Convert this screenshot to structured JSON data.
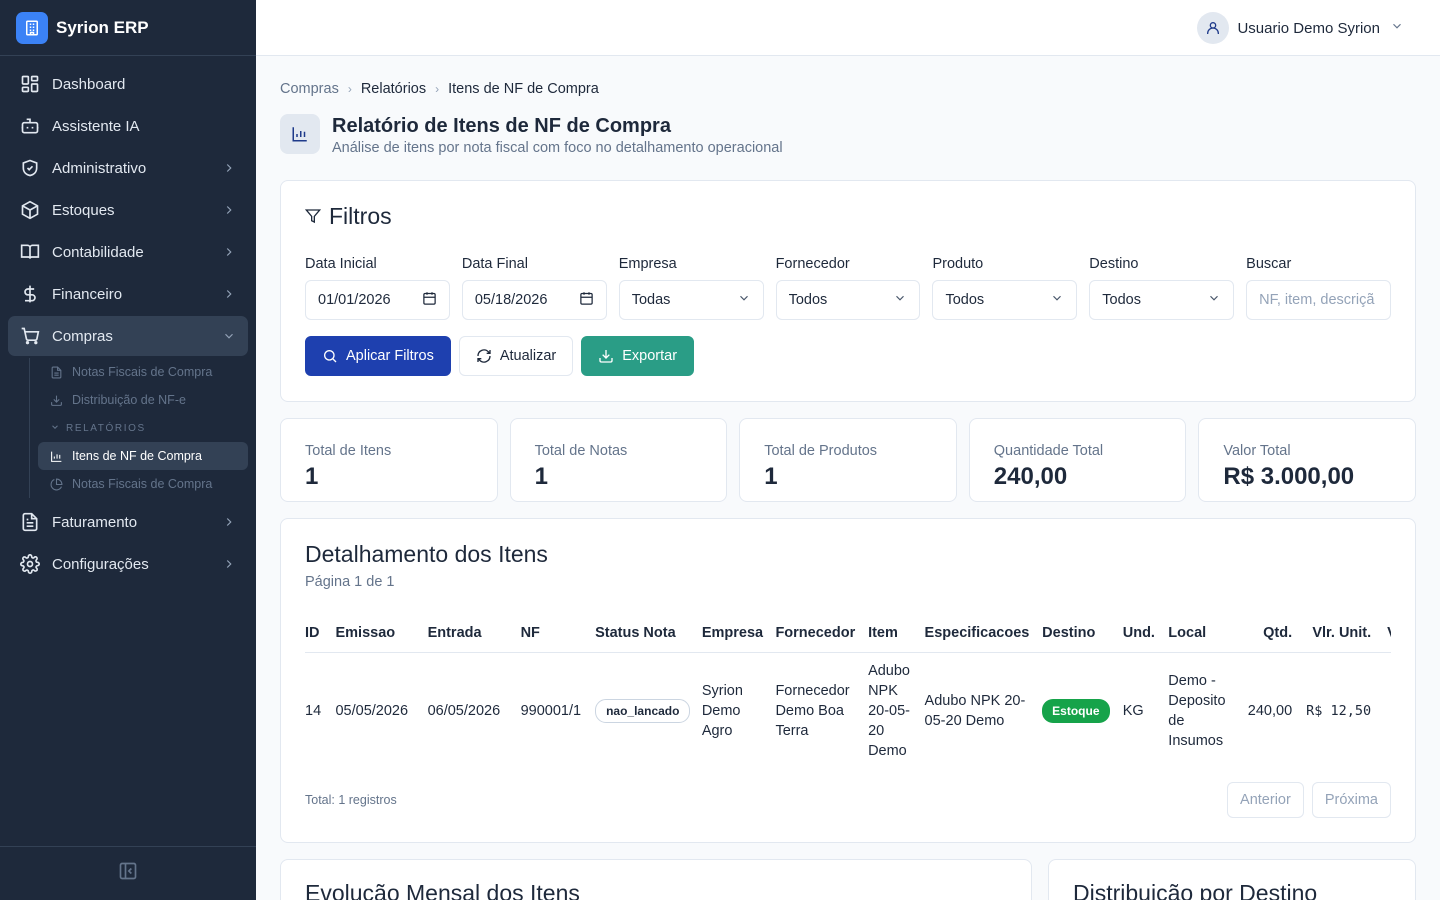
{
  "app": {
    "name": "Syrion ERP"
  },
  "user": {
    "name": "Usuario Demo Syrion"
  },
  "sidebar": {
    "items": [
      {
        "label": "Dashboard",
        "icon": "dashboard-icon"
      },
      {
        "label": "Assistente IA",
        "icon": "bot-icon"
      },
      {
        "label": "Administrativo",
        "icon": "shield-icon"
      },
      {
        "label": "Estoques",
        "icon": "package-icon"
      },
      {
        "label": "Contabilidade",
        "icon": "book-icon"
      },
      {
        "label": "Financeiro",
        "icon": "dollar-icon"
      },
      {
        "label": "Compras",
        "icon": "cart-icon"
      },
      {
        "label": "Faturamento",
        "icon": "file-text-icon"
      },
      {
        "label": "Configurações",
        "icon": "gear-icon"
      }
    ],
    "compras_sub": {
      "items": [
        {
          "label": "Notas Fiscais de Compra"
        },
        {
          "label": "Distribuição de NF-e"
        }
      ],
      "section": "RELATÓRIOS",
      "reports": [
        {
          "label": "Itens de NF de Compra"
        },
        {
          "label": "Notas Fiscais de Compra"
        }
      ]
    }
  },
  "breadcrumb": [
    "Compras",
    "Relatórios",
    "Itens de NF de Compra"
  ],
  "page": {
    "title": "Relatório de Itens de NF de Compra",
    "subtitle": "Análise de itens por nota fiscal com foco no detalhamento operacional"
  },
  "filters": {
    "title": "Filtros",
    "fields": [
      {
        "label": "Data Inicial",
        "value": "01/01/2026",
        "type": "date"
      },
      {
        "label": "Data Final",
        "value": "05/18/2026",
        "type": "date"
      },
      {
        "label": "Empresa",
        "value": "Todas",
        "type": "select"
      },
      {
        "label": "Fornecedor",
        "value": "Todos",
        "type": "select"
      },
      {
        "label": "Produto",
        "value": "Todos",
        "type": "select"
      },
      {
        "label": "Destino",
        "value": "Todos",
        "type": "select"
      },
      {
        "label": "Buscar",
        "placeholder": "NF, item, descriçã",
        "type": "text"
      }
    ],
    "buttons": {
      "apply": "Aplicar Filtros",
      "refresh": "Atualizar",
      "export": "Exportar"
    }
  },
  "stats": [
    {
      "label": "Total de Itens",
      "value": "1"
    },
    {
      "label": "Total de Notas",
      "value": "1"
    },
    {
      "label": "Total de Produtos",
      "value": "1"
    },
    {
      "label": "Quantidade Total",
      "value": "240,00"
    },
    {
      "label": "Valor Total",
      "value": "R$ 3.000,00"
    }
  ],
  "detail": {
    "title": "Detalhamento dos Itens",
    "subtitle": "Página 1 de 1",
    "columns": [
      "ID",
      "Emissao",
      "Entrada",
      "NF",
      "Status Nota",
      "Empresa",
      "Fornecedor",
      "Item",
      "Especificacoes",
      "Destino",
      "Und.",
      "Local",
      "Qtd.",
      "Vlr. Unit.",
      "V"
    ],
    "rows": [
      {
        "id": "14",
        "emissao": "05/05/2026",
        "entrada": "06/05/2026",
        "nf": "990001/1",
        "status": "nao_lancado",
        "empresa": "Syrion Demo Agro",
        "fornecedor": "Fornecedor Demo Boa Terra",
        "item": "Adubo NPK 20-05-20 Demo",
        "especificacoes": "Adubo NPK 20-05-20 Demo",
        "destino": "Estoque",
        "und": "KG",
        "local": "Demo - Deposito de Insumos",
        "qtd": "240,00",
        "vlr_unit": "R$ 12,50"
      }
    ],
    "total": "Total: 1 registros",
    "pager": {
      "prev": "Anterior",
      "next": "Próxima"
    }
  },
  "bottom": {
    "left_title": "Evolução Mensal dos Itens",
    "right_title": "Distribuição por Destino"
  },
  "colors": {
    "sidebar": "#1e293b",
    "primary": "#1e40af",
    "success": "#2a9d86",
    "badge_green": "#16a34a"
  }
}
